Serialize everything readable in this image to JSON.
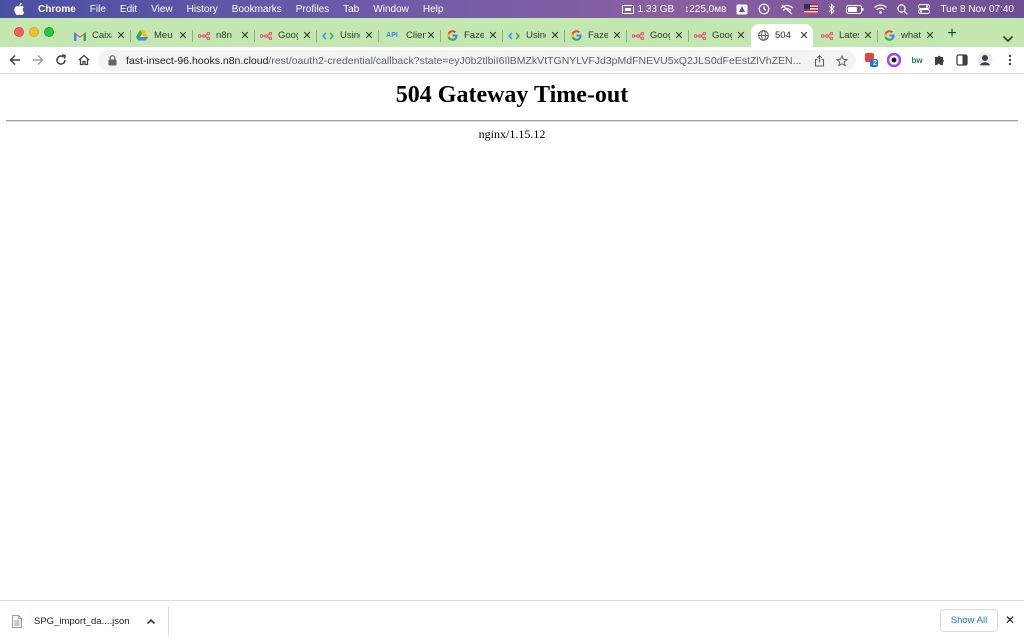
{
  "menubar": {
    "app": "Chrome",
    "items": [
      "File",
      "Edit",
      "View",
      "History",
      "Bookmarks",
      "Profiles",
      "Tab",
      "Window",
      "Help"
    ],
    "memory": "1.33 GB",
    "network": "↕225,0ᴍʙ",
    "datetime": "Tue 8 Nov  07:40"
  },
  "tabs": [
    {
      "title": "Caixa",
      "icon": "gmail-icon"
    },
    {
      "title": "Meu Drive",
      "icon": "google-drive-icon"
    },
    {
      "title": "n8n",
      "icon": "n8n-icon"
    },
    {
      "title": "Google",
      "icon": "n8n-icon"
    },
    {
      "title": "Using",
      "icon": "code-icon"
    },
    {
      "title": "Client",
      "icon": "api-icon"
    },
    {
      "title": "Fazer",
      "icon": "google-icon"
    },
    {
      "title": "Using",
      "icon": "code-icon"
    },
    {
      "title": "Fazer",
      "icon": "google-icon"
    },
    {
      "title": "Google",
      "icon": "n8n-icon"
    },
    {
      "title": "Google",
      "icon": "n8n-icon"
    },
    {
      "title": "504",
      "icon": "globe-icon",
      "active": true
    },
    {
      "title": "Latest",
      "icon": "n8n-icon"
    },
    {
      "title": "what",
      "icon": "google-icon"
    }
  ],
  "omnibox": {
    "host": "fast-insect-96.hooks.n8n.cloud",
    "path": "/rest/oauth2-credential/callback?state=eyJ0b2tlbiI6IlBMZkVtTGNYLVFJd3pMdFNEVU5xQ2JLS0dFeEstZlVhZEN..."
  },
  "extensions": {
    "badge_count": "2",
    "bw_label": "bw"
  },
  "page": {
    "heading": "504 Gateway Time-out",
    "server": "nginx/1.15.12"
  },
  "downloads": {
    "file_name": "SPG_import_da....json",
    "show_all_label": "Show All"
  },
  "colors": {
    "tabstrip": "#c2e7b1",
    "accent_blue": "#1a73e8"
  }
}
